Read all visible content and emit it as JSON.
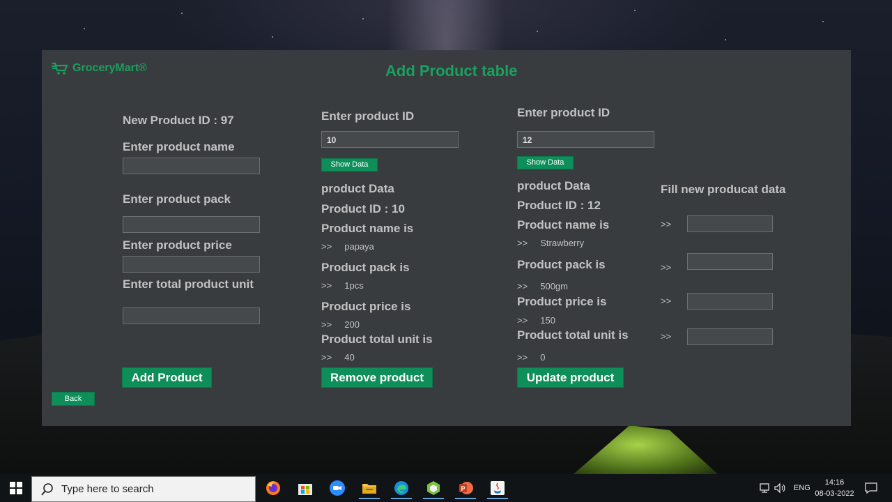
{
  "app": {
    "brand": "GroceryMart®",
    "title": "Add Product table",
    "back_label": "Back"
  },
  "add_panel": {
    "new_id_label": "New Product ID :  97",
    "name_label": "Enter product name",
    "pack_label": "Enter product pack",
    "price_label": "Enter product price",
    "unit_label": "Enter total product unit",
    "name_value": "",
    "pack_value": "",
    "price_value": "",
    "unit_value": "",
    "button": "Add Product"
  },
  "remove_panel": {
    "id_label": "Enter product ID",
    "id_value": "10",
    "show_button": "Show Data",
    "data_header": "product Data",
    "product_id": "Product ID : 10",
    "name_label": "Product name is",
    "name_value": ">>     papaya",
    "pack_label": "Product pack is",
    "pack_value": ">>     1pcs",
    "price_label": "Product price is",
    "price_value": ">>     200",
    "unit_label": "Product total unit is",
    "unit_value": ">>     40",
    "button": "Remove product"
  },
  "update_panel": {
    "id_label": "Enter product ID",
    "id_value": "12",
    "show_button": "Show Data",
    "data_header": "product Data",
    "product_id": "Product ID : 12",
    "name_label": "Product name is",
    "name_value": ">>     Strawberry",
    "pack_label": "Product pack is",
    "pack_value": ">>     500gm",
    "price_label": "Product price is",
    "price_value": ">>     150",
    "unit_label": "Product total unit is",
    "unit_value": ">>     0",
    "fill_header": "Fill new producat data",
    "fill_markers": [
      ">>",
      ">>",
      ">>",
      ">>"
    ],
    "button": "Update product"
  },
  "taskbar": {
    "search_placeholder": "Type here to search",
    "apps": [
      "firefox-icon",
      "microsoft-store-icon",
      "zoom-icon",
      "file-explorer-icon",
      "edge-icon",
      "app-cube-icon",
      "powerpoint-icon",
      "java-icon"
    ],
    "language": "ENG",
    "time": "14:16",
    "date": "08-03-2022"
  },
  "colors": {
    "accent": "#0e8f5a",
    "brand_text": "#1aa060",
    "window_bg": "#393c3f"
  }
}
